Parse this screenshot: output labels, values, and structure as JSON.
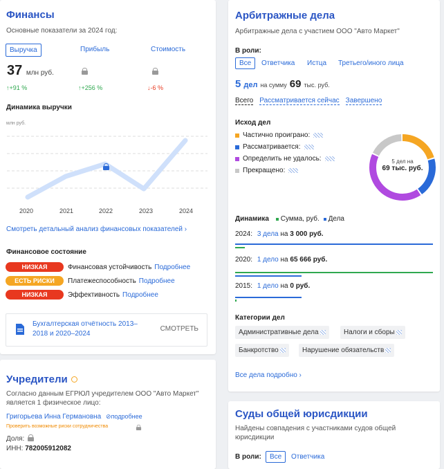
{
  "finance": {
    "title": "Финансы",
    "subtitle": "Основные показатели за 2024 год:",
    "tabs": [
      {
        "label": "Выручка",
        "selected": true
      },
      {
        "label": "Прибыль",
        "selected": false
      },
      {
        "label": "Стоимость",
        "selected": false
      }
    ],
    "revenue_value": "37",
    "revenue_unit": "млн руб.",
    "deltas": [
      "↑+91 %",
      "↑+256 %",
      "↓-6 %"
    ],
    "dynamics_title": "Динамика выручки",
    "unit_label": "млн руб.",
    "years": [
      "2020",
      "2021",
      "2022",
      "2023",
      "2024"
    ],
    "detail_link": "Смотреть детальный анализ финансовых показателей ›",
    "state_title": "Финансовое состояние",
    "risks": [
      {
        "badge": "НИЗКАЯ",
        "label": "Финансовая устойчивость",
        "link": "Подробнее",
        "color": "#e8381f"
      },
      {
        "badge": "ЕСТЬ РИСКИ",
        "label": "Платежеспособность",
        "link": "Подробнее",
        "color": "#f5a623"
      },
      {
        "badge": "НИЗКАЯ",
        "label": "Эффективность",
        "link": "Подробнее",
        "color": "#e8381f"
      }
    ],
    "doc_title": "Бухгалтерская отчётность 2013–2018 и 2020–2024",
    "doc_action": "СМОТРЕТЬ"
  },
  "founders": {
    "title": "Учредители",
    "text": "Согласно данным ЕГРЮЛ учредителем ООО \"Авто Маркет\" является 1 физическое лицо:",
    "person": "Григорьева Инна Германовна",
    "more": "подробнее",
    "risk_check": "Проверить возможные риски сотрудничества",
    "share_label": "Доля:",
    "inn_label": "ИНН:",
    "inn": "782005912082"
  },
  "arbitration": {
    "title": "Арбитражные дела",
    "subtitle": "Арбитражные дела с участием ООО \"Авто Маркет\"",
    "role_label": "В роли:",
    "roles": [
      "Все",
      "Ответчика",
      "Истца",
      "Третьего/иного лица"
    ],
    "cases_count": "5",
    "cases_word": "дел",
    "sum_prefix": "на сумму",
    "sum_value": "69",
    "sum_unit": "тыс. руб.",
    "filters": [
      "Всего",
      "Рассматривается сейчас",
      "Завершено"
    ],
    "outcome_title": "Исход дел",
    "outcomes": [
      {
        "label": "Частично проиграно:",
        "color": "#f5a623"
      },
      {
        "label": "Рассматривается:",
        "color": "#2a6ad8"
      },
      {
        "label": "Определить не удалось:",
        "color": "#b04ae0"
      },
      {
        "label": "Прекращено:",
        "color": "#c8c8c8"
      }
    ],
    "donut_line1": "5 дел на",
    "donut_line2": "69 тыс. руб.",
    "dynamics_title": "Динамика",
    "legend_sum": "Сумма, руб.",
    "legend_cases": "Дела",
    "years": [
      {
        "year": "2024:",
        "cases": "3 дела",
        "mid": "на",
        "amount": "3 000 руб."
      },
      {
        "year": "2020:",
        "cases": "1 дело",
        "mid": "на",
        "amount": "65 666 руб."
      },
      {
        "year": "2015:",
        "cases": "1 дело",
        "mid": "на",
        "amount": "0 руб."
      }
    ],
    "categories_title": "Категории дел",
    "categories": [
      "Административные дела",
      "Налоги и сборы",
      "Банкротство",
      "Нарушение обязательств"
    ],
    "all_link": "Все дела подробно ›"
  },
  "courts": {
    "title": "Суды общей юрисдикции",
    "subtitle": "Найдены совпадения с участниками судов общей юрисдикции",
    "role_label": "В роли:",
    "roles": [
      "Все",
      "Ответчика"
    ]
  }
}
